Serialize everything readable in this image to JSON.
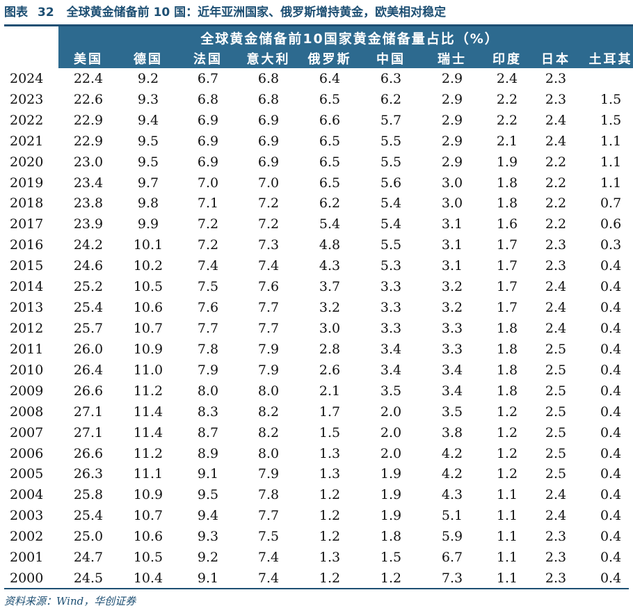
{
  "figure": {
    "label": "图表",
    "number": "32",
    "title": "全球黄金储备前 10 国：近年亚洲国家、俄罗斯增持黄金，欧美相对稳定"
  },
  "table": {
    "header_title": "全球黄金储备前10国家黄金储备量占比（%）",
    "columns": [
      "美国",
      "德国",
      "法国",
      "意大利",
      "俄罗斯",
      "中国",
      "瑞士",
      "印度",
      "日本",
      "土耳其"
    ],
    "rows": [
      {
        "year": "2024",
        "values": [
          "22.4",
          "9.2",
          "6.7",
          "6.8",
          "6.4",
          "6.3",
          "2.9",
          "2.4",
          "2.3",
          ""
        ]
      },
      {
        "year": "2023",
        "values": [
          "22.6",
          "9.3",
          "6.8",
          "6.8",
          "6.5",
          "6.2",
          "2.9",
          "2.2",
          "2.3",
          "1.5"
        ]
      },
      {
        "year": "2022",
        "values": [
          "22.9",
          "9.4",
          "6.9",
          "6.9",
          "6.6",
          "5.7",
          "2.9",
          "2.2",
          "2.4",
          "1.5"
        ]
      },
      {
        "year": "2021",
        "values": [
          "22.9",
          "9.5",
          "6.9",
          "6.9",
          "6.5",
          "5.5",
          "2.9",
          "2.1",
          "2.4",
          "1.1"
        ]
      },
      {
        "year": "2020",
        "values": [
          "23.0",
          "9.5",
          "6.9",
          "6.9",
          "6.5",
          "5.5",
          "2.9",
          "1.9",
          "2.2",
          "1.1"
        ]
      },
      {
        "year": "2019",
        "values": [
          "23.4",
          "9.7",
          "7.0",
          "7.0",
          "6.5",
          "5.6",
          "3.0",
          "1.8",
          "2.2",
          "1.1"
        ]
      },
      {
        "year": "2018",
        "values": [
          "23.8",
          "9.8",
          "7.1",
          "7.2",
          "6.2",
          "5.4",
          "3.0",
          "1.8",
          "2.2",
          "0.7"
        ]
      },
      {
        "year": "2017",
        "values": [
          "23.9",
          "9.9",
          "7.2",
          "7.2",
          "5.4",
          "5.4",
          "3.1",
          "1.6",
          "2.2",
          "0.6"
        ]
      },
      {
        "year": "2016",
        "values": [
          "24.2",
          "10.1",
          "7.2",
          "7.3",
          "4.8",
          "5.5",
          "3.1",
          "1.7",
          "2.3",
          "0.3"
        ]
      },
      {
        "year": "2015",
        "values": [
          "24.6",
          "10.2",
          "7.4",
          "7.4",
          "4.3",
          "5.3",
          "3.1",
          "1.7",
          "2.3",
          "0.4"
        ]
      },
      {
        "year": "2014",
        "values": [
          "25.2",
          "10.5",
          "7.5",
          "7.6",
          "3.7",
          "3.3",
          "3.2",
          "1.7",
          "2.4",
          "0.4"
        ]
      },
      {
        "year": "2013",
        "values": [
          "25.4",
          "10.6",
          "7.6",
          "7.7",
          "3.2",
          "3.3",
          "3.2",
          "1.7",
          "2.4",
          "0.4"
        ]
      },
      {
        "year": "2012",
        "values": [
          "25.7",
          "10.7",
          "7.7",
          "7.7",
          "3.0",
          "3.3",
          "3.3",
          "1.8",
          "2.4",
          "0.4"
        ]
      },
      {
        "year": "2011",
        "values": [
          "26.0",
          "10.9",
          "7.8",
          "7.9",
          "2.8",
          "3.4",
          "3.3",
          "1.8",
          "2.5",
          "0.4"
        ]
      },
      {
        "year": "2010",
        "values": [
          "26.4",
          "11.0",
          "7.9",
          "7.9",
          "2.6",
          "3.4",
          "3.4",
          "1.8",
          "2.5",
          "0.4"
        ]
      },
      {
        "year": "2009",
        "values": [
          "26.6",
          "11.2",
          "8.0",
          "8.0",
          "2.1",
          "3.5",
          "3.4",
          "1.8",
          "2.5",
          "0.4"
        ]
      },
      {
        "year": "2008",
        "values": [
          "27.1",
          "11.4",
          "8.3",
          "8.2",
          "1.7",
          "2.0",
          "3.5",
          "1.2",
          "2.5",
          "0.4"
        ]
      },
      {
        "year": "2007",
        "values": [
          "27.1",
          "11.4",
          "8.7",
          "8.2",
          "1.5",
          "2.0",
          "3.8",
          "1.2",
          "2.5",
          "0.4"
        ]
      },
      {
        "year": "2006",
        "values": [
          "26.6",
          "11.2",
          "8.9",
          "8.0",
          "1.3",
          "2.0",
          "4.2",
          "1.2",
          "2.5",
          "0.4"
        ]
      },
      {
        "year": "2005",
        "values": [
          "26.3",
          "11.1",
          "9.1",
          "7.9",
          "1.3",
          "1.9",
          "4.2",
          "1.2",
          "2.5",
          "0.4"
        ]
      },
      {
        "year": "2004",
        "values": [
          "25.8",
          "10.9",
          "9.5",
          "7.8",
          "1.2",
          "1.9",
          "4.3",
          "1.1",
          "2.4",
          "0.4"
        ]
      },
      {
        "year": "2003",
        "values": [
          "25.4",
          "10.7",
          "9.4",
          "7.7",
          "1.2",
          "1.9",
          "5.1",
          "1.1",
          "2.4",
          "0.4"
        ]
      },
      {
        "year": "2002",
        "values": [
          "25.0",
          "10.6",
          "9.3",
          "7.5",
          "1.2",
          "1.8",
          "5.9",
          "1.1",
          "2.3",
          "0.4"
        ]
      },
      {
        "year": "2001",
        "values": [
          "24.7",
          "10.5",
          "9.2",
          "7.4",
          "1.3",
          "1.5",
          "6.7",
          "1.1",
          "2.3",
          "0.4"
        ]
      },
      {
        "year": "2000",
        "values": [
          "24.5",
          "10.4",
          "9.1",
          "7.4",
          "1.2",
          "1.2",
          "7.3",
          "1.1",
          "2.3",
          "0.4"
        ]
      }
    ]
  },
  "source": "资料来源：Wind，华创证券",
  "colors": {
    "header_bg": "#2d6a8f",
    "accent": "#1d4f73",
    "header_text": "#ffffff"
  }
}
